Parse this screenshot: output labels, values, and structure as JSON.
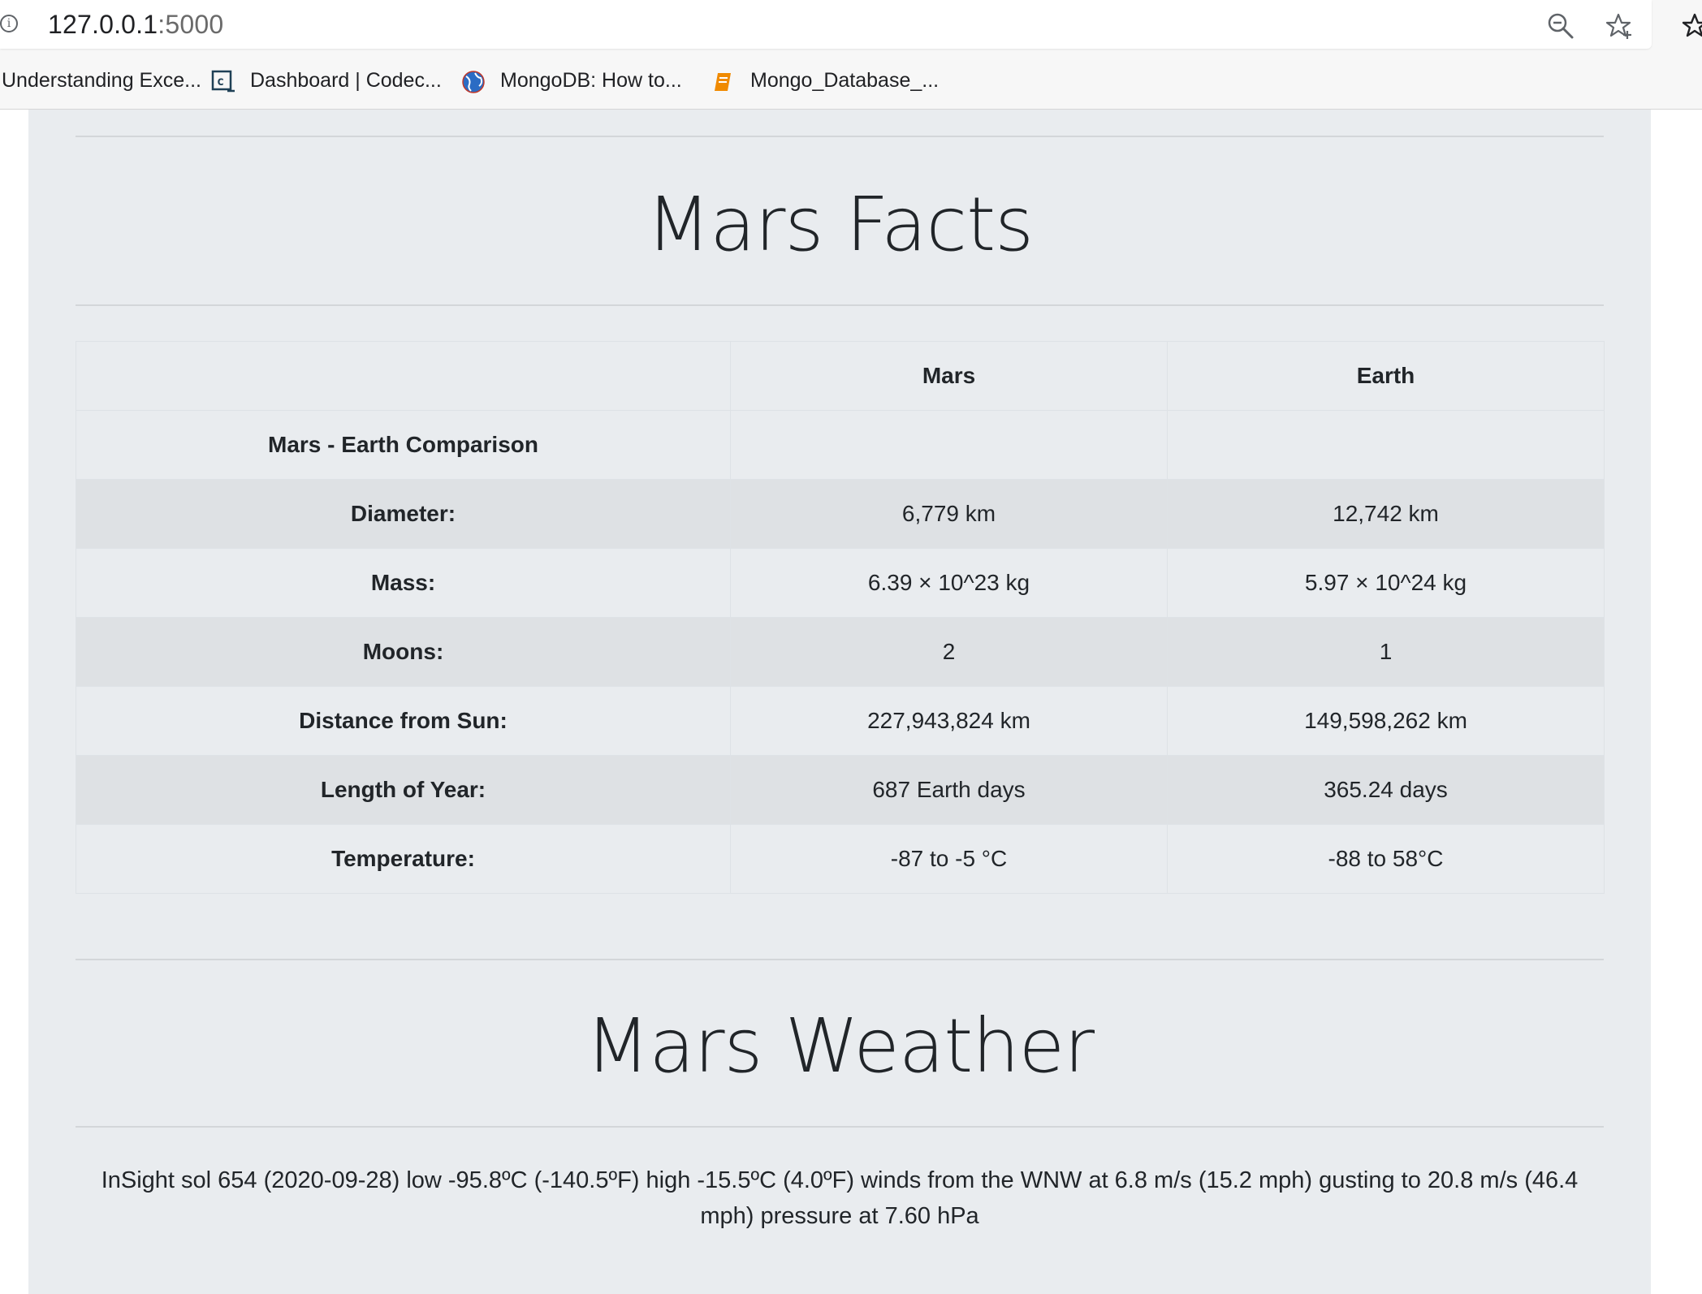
{
  "browser": {
    "url_host": "127.0.0.1",
    "url_port": ":5000",
    "info_icon": "info-icon",
    "bookmarks": [
      {
        "label": "Understanding Exce...",
        "icon": "none"
      },
      {
        "label": "Dashboard | Codec...",
        "icon": "codecademy-icon"
      },
      {
        "label": "MongoDB: How to...",
        "icon": "globe-icon"
      },
      {
        "label": "Mongo_Database_...",
        "icon": "book-icon"
      }
    ]
  },
  "facts": {
    "title": "Mars Facts",
    "header": {
      "col0": "",
      "col1": "Mars",
      "col2": "Earth"
    },
    "rows": [
      {
        "label": "Mars - Earth Comparison",
        "mars": "",
        "earth": ""
      },
      {
        "label": "Diameter:",
        "mars": "6,779 km",
        "earth": "12,742 km"
      },
      {
        "label": "Mass:",
        "mars": "6.39 × 10^23 kg",
        "earth": "5.97 × 10^24 kg"
      },
      {
        "label": "Moons:",
        "mars": "2",
        "earth": "1"
      },
      {
        "label": "Distance from Sun:",
        "mars": "227,943,824 km",
        "earth": "149,598,262 km"
      },
      {
        "label": "Length of Year:",
        "mars": "687 Earth days",
        "earth": "365.24 days"
      },
      {
        "label": "Temperature:",
        "mars": "-87 to -5 °C",
        "earth": "-88 to 58°C"
      }
    ]
  },
  "weather": {
    "title": "Mars Weather",
    "text": "InSight sol 654 (2020-09-28) low -95.8ºC (-140.5ºF) high -15.5ºC (4.0ºF) winds from the WNW at 6.8 m/s (15.2 mph) gusting to 20.8 m/s (46.4 mph) pressure at 7.60 hPa"
  },
  "colors": {
    "page_bg": "#e9ecef",
    "striped_row": "#dee1e4",
    "text": "#212529"
  }
}
